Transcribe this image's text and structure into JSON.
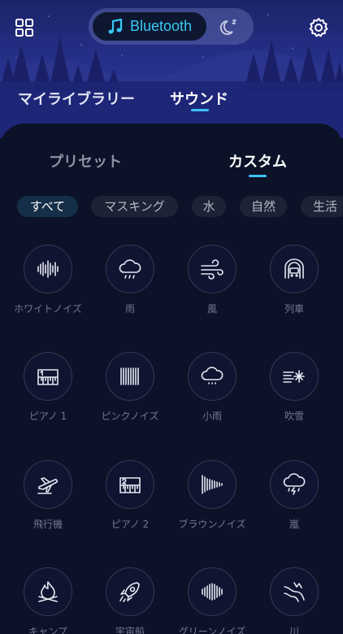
{
  "header": {
    "bluetooth_label": "Bluetooth",
    "accent_color": "#39c8f4"
  },
  "top_tabs": [
    {
      "label": "マイライブラリー",
      "active": false
    },
    {
      "label": "サウンド",
      "active": true
    }
  ],
  "sub_tabs": [
    {
      "label": "プリセット",
      "active": false
    },
    {
      "label": "カスタム",
      "active": true
    }
  ],
  "chips": [
    {
      "label": "すべて",
      "active": true
    },
    {
      "label": "マスキング",
      "active": false
    },
    {
      "label": "水",
      "active": false
    },
    {
      "label": "自然",
      "active": false
    },
    {
      "label": "生活",
      "active": false
    }
  ],
  "sounds": [
    {
      "label": "ホワイトノイズ",
      "icon": "white-noise-icon"
    },
    {
      "label": "雨",
      "icon": "rain-cloud-icon"
    },
    {
      "label": "風",
      "icon": "wind-icon"
    },
    {
      "label": "列車",
      "icon": "train-icon"
    },
    {
      "label": "ピアノ 1",
      "icon": "piano-1-icon"
    },
    {
      "label": "ピンクノイズ",
      "icon": "pink-noise-icon"
    },
    {
      "label": "小雨",
      "icon": "light-rain-icon"
    },
    {
      "label": "吹雪",
      "icon": "snowstorm-icon"
    },
    {
      "label": "飛行機",
      "icon": "airplane-icon"
    },
    {
      "label": "ピアノ 2",
      "icon": "piano-2-icon"
    },
    {
      "label": "ブラウンノイズ",
      "icon": "brown-noise-icon"
    },
    {
      "label": "嵐",
      "icon": "storm-icon"
    },
    {
      "label": "キャンプ",
      "icon": "campfire-icon"
    },
    {
      "label": "宇宙船",
      "icon": "rocket-icon"
    },
    {
      "label": "グリーンノイズ",
      "icon": "green-noise-icon"
    },
    {
      "label": "川",
      "icon": "river-icon"
    }
  ]
}
